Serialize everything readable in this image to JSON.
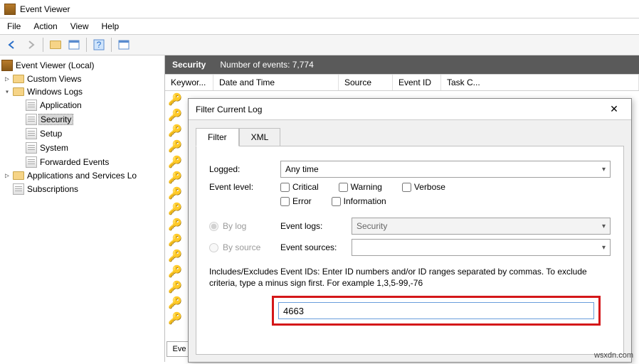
{
  "window_title": "Event Viewer",
  "menu": {
    "file": "File",
    "action": "Action",
    "view": "View",
    "help": "Help"
  },
  "tree": {
    "root": "Event Viewer (Local)",
    "custom_views": "Custom Views",
    "windows_logs": "Windows Logs",
    "logs": {
      "application": "Application",
      "security": "Security",
      "setup": "Setup",
      "system": "System",
      "forwarded": "Forwarded Events"
    },
    "apps_services": "Applications and Services Lo",
    "subscriptions": "Subscriptions"
  },
  "headerbar": {
    "name": "Security",
    "count_label": "Number of events: 7,774"
  },
  "grid": {
    "c0": "Keywor...",
    "c1": "Date and Time",
    "c2": "Source",
    "c3": "Event ID",
    "c4": "Task C...",
    "eve": "Eve"
  },
  "dialog": {
    "title": "Filter Current Log",
    "tabs": {
      "filter": "Filter",
      "xml": "XML"
    },
    "labels": {
      "logged": "Logged:",
      "event_level": "Event level:",
      "by_log": "By log",
      "by_source": "By source",
      "event_logs": "Event logs:",
      "event_sources": "Event sources:"
    },
    "logged_value": "Any time",
    "levels": {
      "critical": "Critical",
      "warning": "Warning",
      "verbose": "Verbose",
      "error": "Error",
      "information": "Information"
    },
    "event_logs_value": "Security",
    "desc": "Includes/Excludes Event IDs: Enter ID numbers and/or ID ranges separated by commas. To exclude criteria, type a minus sign first. For example 1,3,5-99,-76",
    "id_value": "4663"
  },
  "watermark": "wsxdn.com"
}
